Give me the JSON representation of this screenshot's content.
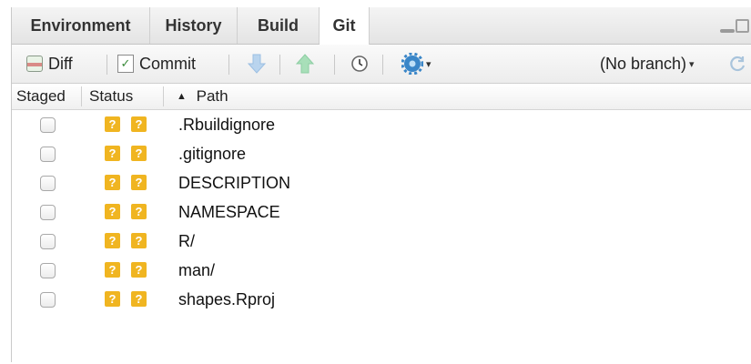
{
  "tabs": [
    {
      "label": "Environment",
      "active": false
    },
    {
      "label": "History",
      "active": false
    },
    {
      "label": "Build",
      "active": false
    },
    {
      "label": "Git",
      "active": true
    }
  ],
  "toolbar": {
    "diff_label": "Diff",
    "commit_label": "Commit",
    "branch_label": "(No branch)",
    "icons": [
      "diff-icon",
      "commit-icon",
      "pull-arrow-icon",
      "push-arrow-icon",
      "history-clock-icon",
      "gear-icon",
      "refresh-icon"
    ]
  },
  "columns": {
    "staged": "Staged",
    "status": "Status",
    "path": "Path"
  },
  "status_symbol": "?",
  "files": [
    {
      "path": ".Rbuildignore"
    },
    {
      "path": ".gitignore"
    },
    {
      "path": "DESCRIPTION"
    },
    {
      "path": "NAMESPACE"
    },
    {
      "path": "R/"
    },
    {
      "path": "man/"
    },
    {
      "path": "shapes.Rproj"
    }
  ],
  "colors": {
    "status_badge": "#f0b521",
    "accent_blue": "#3a86c8",
    "arrow_green": "#7fce9a"
  }
}
